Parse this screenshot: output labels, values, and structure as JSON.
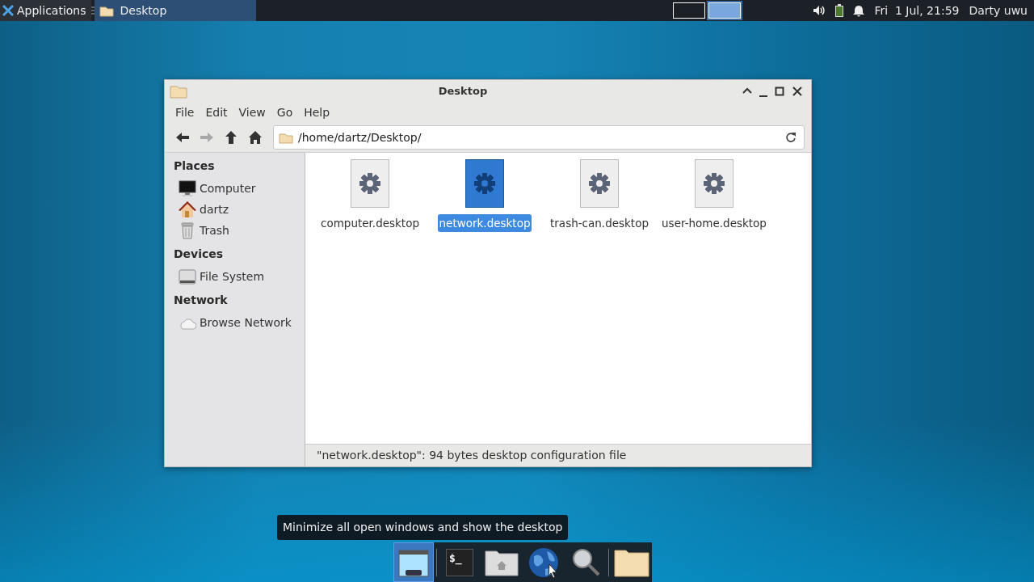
{
  "panel": {
    "applications_label": "Applications",
    "tasks": [
      {
        "label": "Desktop",
        "selected": true
      }
    ],
    "workspaces": [
      {
        "selected": false
      },
      {
        "selected": true
      }
    ],
    "clock": "Fri  1 Jul, 21:59",
    "user": "Darty uwu"
  },
  "window": {
    "title": "Desktop",
    "menu": [
      "File",
      "Edit",
      "View",
      "Go",
      "Help"
    ],
    "toolbar": [
      {
        "kind": "back",
        "disabled": false
      },
      {
        "kind": "forward",
        "disabled": true
      },
      {
        "kind": "up",
        "disabled": false
      },
      {
        "kind": "home",
        "disabled": false
      }
    ],
    "location": "/home/dartz/Desktop/",
    "sidebar": [
      {
        "heading": "Places",
        "items": [
          {
            "kind": "computer",
            "label": "Computer"
          },
          {
            "kind": "home",
            "label": "dartz"
          },
          {
            "kind": "trash",
            "label": "Trash"
          }
        ]
      },
      {
        "heading": "Devices",
        "items": [
          {
            "kind": "drive",
            "label": "File System"
          }
        ]
      },
      {
        "heading": "Network",
        "items": [
          {
            "kind": "cloud",
            "label": "Browse Network"
          }
        ]
      }
    ],
    "files": [
      {
        "name": "computer.desktop",
        "selected": false
      },
      {
        "name": "network.desktop",
        "selected": true
      },
      {
        "name": "trash-can.desktop",
        "selected": false
      },
      {
        "name": "user-home.desktop",
        "selected": false
      }
    ],
    "status_bar": "\"network.desktop\": 94 bytes desktop configuration file"
  },
  "tooltip": "Minimize all open windows and show the desktop",
  "dock": [
    {
      "kind": "show-desktop",
      "selected": true
    },
    {
      "kind": "separator"
    },
    {
      "kind": "terminal",
      "prompt": "$_",
      "selected": false
    },
    {
      "kind": "home-folder",
      "selected": false
    },
    {
      "kind": "globe",
      "selected": false
    },
    {
      "kind": "search",
      "selected": false
    },
    {
      "kind": "separator"
    },
    {
      "kind": "folder",
      "selected": false
    }
  ]
}
